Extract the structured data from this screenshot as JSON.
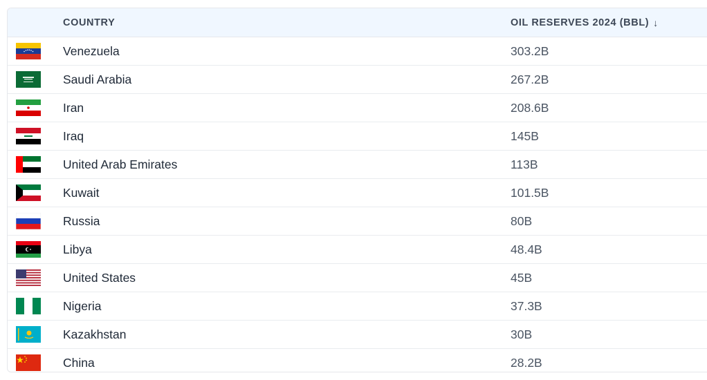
{
  "header": {
    "country_label": "COUNTRY",
    "reserves_label": "OIL RESERVES 2024 (BBL)",
    "sort_icon": "arrow-down-icon"
  },
  "rows": [
    {
      "country": "Venezuela",
      "reserve": "303.2B",
      "flag": "venezuela-flag-icon"
    },
    {
      "country": "Saudi Arabia",
      "reserve": "267.2B",
      "flag": "saudi-arabia-flag-icon"
    },
    {
      "country": "Iran",
      "reserve": "208.6B",
      "flag": "iran-flag-icon"
    },
    {
      "country": "Iraq",
      "reserve": "145B",
      "flag": "iraq-flag-icon"
    },
    {
      "country": "United Arab Emirates",
      "reserve": "113B",
      "flag": "uae-flag-icon"
    },
    {
      "country": "Kuwait",
      "reserve": "101.5B",
      "flag": "kuwait-flag-icon"
    },
    {
      "country": "Russia",
      "reserve": "80B",
      "flag": "russia-flag-icon"
    },
    {
      "country": "Libya",
      "reserve": "48.4B",
      "flag": "libya-flag-icon"
    },
    {
      "country": "United States",
      "reserve": "45B",
      "flag": "usa-flag-icon"
    },
    {
      "country": "Nigeria",
      "reserve": "37.3B",
      "flag": "nigeria-flag-icon"
    },
    {
      "country": "Kazakhstan",
      "reserve": "30B",
      "flag": "kazakhstan-flag-icon"
    },
    {
      "country": "China",
      "reserve": "28.2B",
      "flag": "china-flag-icon"
    }
  ]
}
